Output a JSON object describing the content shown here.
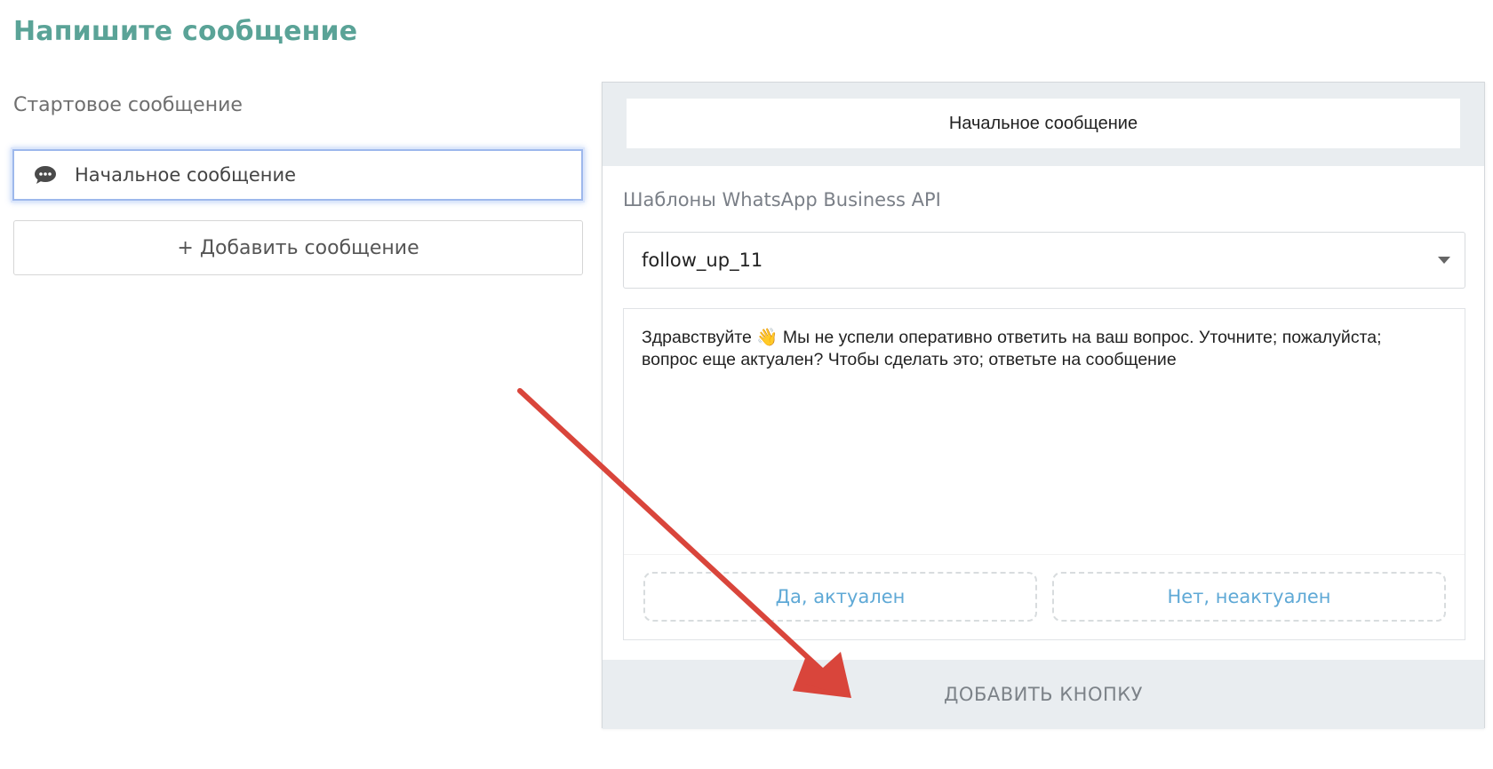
{
  "page": {
    "title": "Напишите сообщение"
  },
  "left": {
    "section_label": "Стартовое сообщение",
    "messages": [
      {
        "label": "Начальное сообщение",
        "icon": "chat-bubble-icon",
        "selected": true
      }
    ],
    "add_message_label": "+ Добавить сообщение"
  },
  "editor": {
    "header_title": "Начальное сообщение",
    "templates_label": "Шаблоны WhatsApp Business API",
    "template_selected": "follow_up_11",
    "dropdown_icon": "chevron-down-icon",
    "message_text": "Здравствуйте 👋 Мы не успели оперативно ответить на ваш вопрос. Уточните; пожалуйста; вопрос еще актуален? Чтобы сделать это; ответьте на сообщение",
    "quick_replies": [
      {
        "label": "Да, актуален"
      },
      {
        "label": "Нет, неактуален"
      }
    ],
    "add_button_label": "ДОБАВИТЬ КНОПКУ"
  },
  "colors": {
    "title": "#5aa397",
    "selected_border": "#9db8ec",
    "quick_reply_text": "#5fa9d6",
    "panel_bg": "#e9edf0",
    "annotation_arrow": "#d9453b"
  }
}
